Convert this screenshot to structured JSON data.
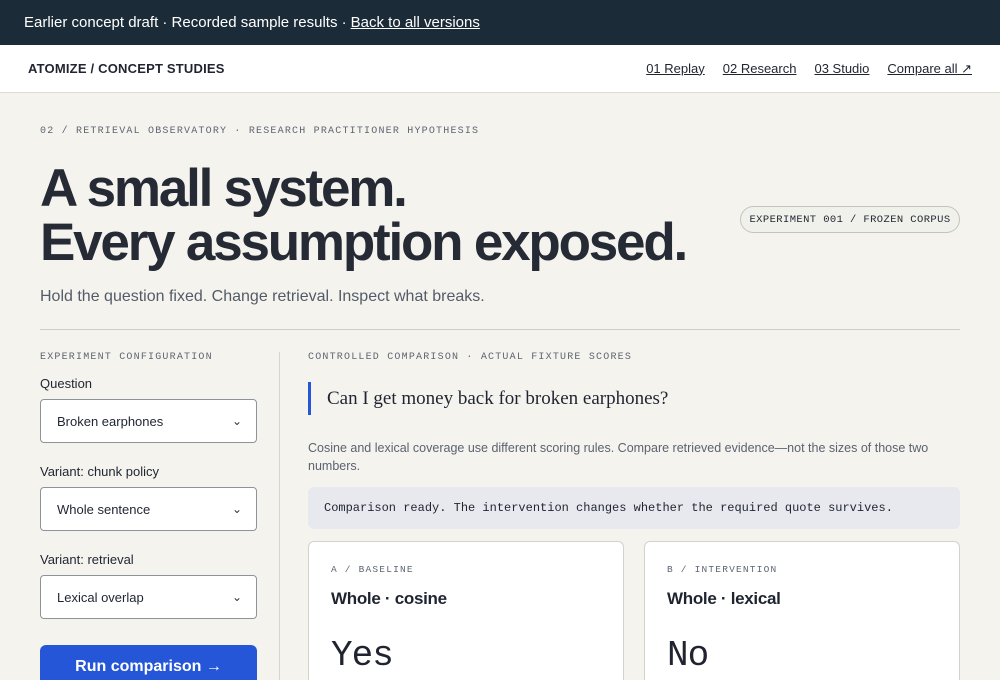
{
  "banner": {
    "text": "Earlier concept draft · Recorded sample results ·",
    "link": "Back to all versions"
  },
  "nav": {
    "brand": "ATOMIZE / CONCEPT STUDIES",
    "links": [
      "01 Replay",
      "02 Research",
      "03 Studio",
      "Compare all ↗"
    ]
  },
  "hero": {
    "eyebrow": "02 / RETRIEVAL OBSERVATORY · RESEARCH PRACTITIONER HYPOTHESIS",
    "line1": "A small system.",
    "line2": "Every assumption exposed.",
    "subtitle": "Hold the question fixed. Change retrieval. Inspect what breaks.",
    "badge": "EXPERIMENT 001 / FROZEN CORPUS"
  },
  "config": {
    "section_label": "EXPERIMENT CONFIGURATION",
    "fields": [
      {
        "label": "Question",
        "value": "Broken earphones"
      },
      {
        "label": "Variant: chunk policy",
        "value": "Whole sentence"
      },
      {
        "label": "Variant: retrieval",
        "value": "Lexical overlap"
      }
    ],
    "run_label": "Run comparison →"
  },
  "comparison": {
    "section_label": "CONTROLLED COMPARISON · ACTUAL FIXTURE SCORES",
    "question": "Can I get money back for broken earphones?",
    "note": "Cosine and lexical coverage use different scoring rules. Compare retrieved evidence—not the sizes of those two numbers.",
    "status": "Comparison ready. The intervention changes whether the required quote survives.",
    "cards": [
      {
        "tag": "A / BASELINE",
        "title": "Whole · cosine",
        "result": "Yes"
      },
      {
        "tag": "B / INTERVENTION",
        "title": "Whole · lexical",
        "result": "No"
      }
    ]
  },
  "colors": {
    "banner_bg": "#1c2b38",
    "page_bg": "#f4f3ee",
    "accent": "#2556d8"
  }
}
